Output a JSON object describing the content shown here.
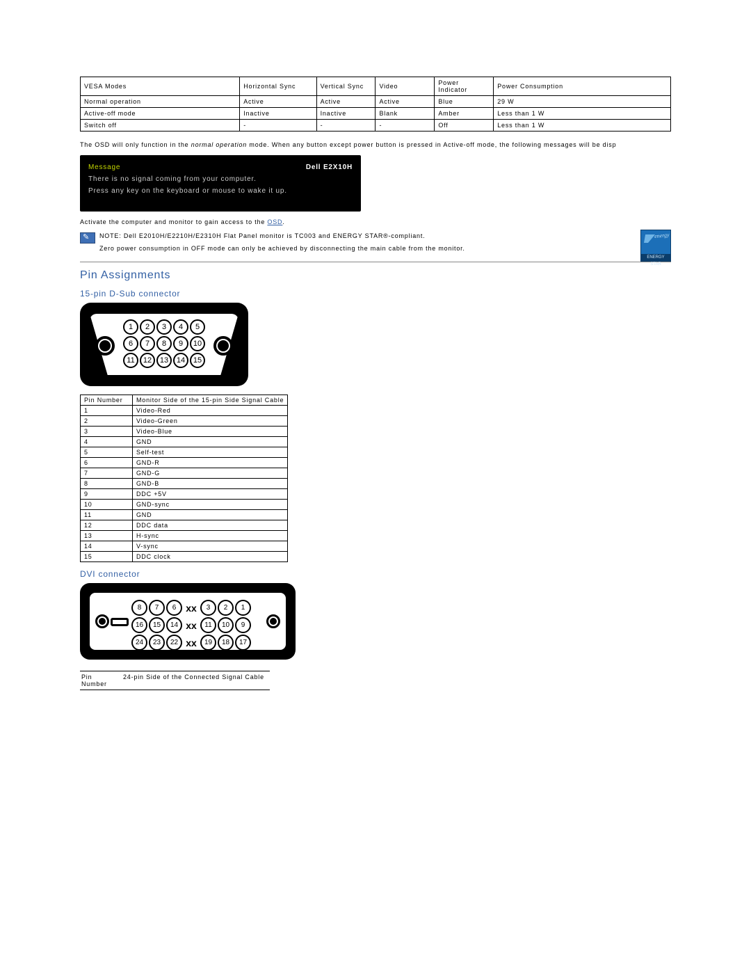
{
  "vesa_table": {
    "headers": [
      "VESA Modes",
      "Horizontal Sync",
      "Vertical Sync",
      "Video",
      "Power Indicator",
      "Power Consumption"
    ],
    "rows": [
      [
        "Normal operation",
        "Active",
        "Active",
        "Active",
        "Blue",
        "29 W"
      ],
      [
        "Active-off mode",
        "Inactive",
        "Inactive",
        "Blank",
        "Amber",
        "Less than 1 W"
      ],
      [
        "Switch off",
        "-",
        "-",
        "-",
        "Off",
        "Less than 1 W"
      ]
    ]
  },
  "osd_paragraph_prefix": "The OSD will only function in the ",
  "osd_paragraph_em": "normal operation",
  "osd_paragraph_suffix": " mode. When any button except power button is pressed in Active-off mode, the following messages will be disp",
  "osd_box": {
    "message_label": "Message",
    "model": "Dell E2X10H",
    "line1": "There is no signal coming from your computer.",
    "line2": "Press any key on the keyboard or mouse to wake it up."
  },
  "activate_prefix": "Activate the computer and monitor to gain access to the ",
  "activate_link": "OSD",
  "activate_suffix": ".",
  "note": {
    "prefix": "NOTE: ",
    "line1": "Dell E2010H/E2210H/E2310H Flat Panel monitor is TC003 and ENERGY STAR®-compliant.",
    "line2": "Zero power consumption in OFF mode can only be achieved by disconnecting the main cable from the monitor."
  },
  "energy_star": {
    "script": "energy",
    "bar": "ENERGY STAR"
  },
  "headings": {
    "pin_assignments": "Pin Assignments",
    "dsub": "15-pin D-Sub connector",
    "dvi": "DVI connector"
  },
  "dsub_diagram": {
    "row1": [
      "1",
      "2",
      "3",
      "4",
      "5"
    ],
    "row2": [
      "6",
      "7",
      "8",
      "9",
      "10"
    ],
    "row3": [
      "11",
      "12",
      "13",
      "14",
      "15"
    ]
  },
  "dsub_table": {
    "headers": [
      "Pin Number",
      "Monitor Side of the 15-pin Side Signal Cable"
    ],
    "rows": [
      [
        "1",
        "Video-Red"
      ],
      [
        "2",
        "Video-Green"
      ],
      [
        "3",
        "Video-Blue"
      ],
      [
        "4",
        "GND"
      ],
      [
        "5",
        "Self-test"
      ],
      [
        "6",
        "GND-R"
      ],
      [
        "7",
        "GND-G"
      ],
      [
        "8",
        "GND-B"
      ],
      [
        "9",
        "DDC +5V"
      ],
      [
        "10",
        "GND-sync"
      ],
      [
        "11",
        "GND"
      ],
      [
        "12",
        "DDC data"
      ],
      [
        "13",
        "H-sync"
      ],
      [
        "14",
        "V-sync"
      ],
      [
        "15",
        "DDC clock"
      ]
    ]
  },
  "dvi_diagram": {
    "xx": "xx",
    "row1_left": [
      "8",
      "7",
      "6"
    ],
    "row1_right": [
      "3",
      "2",
      "1"
    ],
    "row2_left": [
      "16",
      "15",
      "14"
    ],
    "row2_right": [
      "11",
      "10",
      "9"
    ],
    "row3_left": [
      "24",
      "23",
      "22"
    ],
    "row3_right": [
      "19",
      "18",
      "17"
    ]
  },
  "dvi_table": {
    "headers": [
      "Pin Number",
      "24-pin Side of the Connected Signal Cable"
    ]
  }
}
